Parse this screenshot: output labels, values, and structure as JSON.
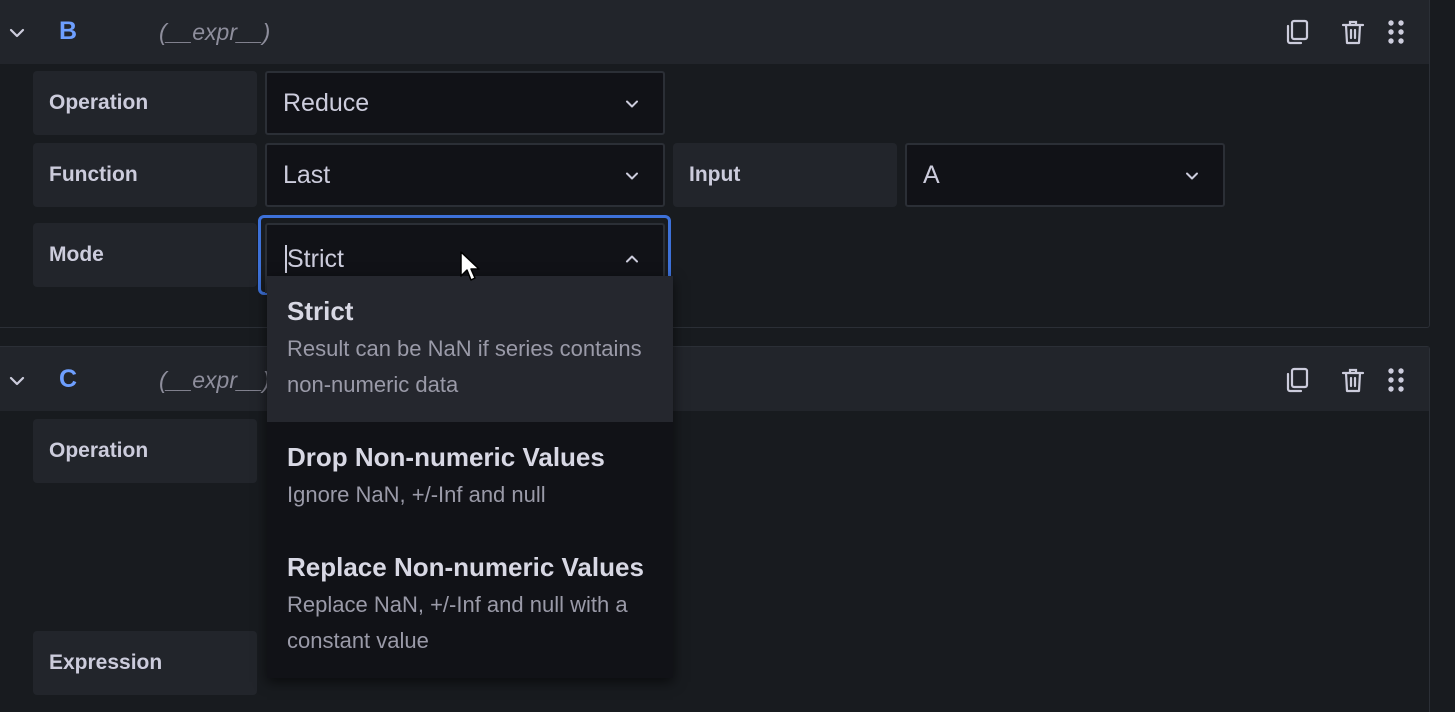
{
  "query_b": {
    "name": "B",
    "type": "(__expr__)",
    "rows": {
      "operation": {
        "label": "Operation",
        "value": "Reduce"
      },
      "function": {
        "label": "Function",
        "value": "Last"
      },
      "input": {
        "label": "Input",
        "value": "A"
      },
      "mode": {
        "label": "Mode",
        "value": "Strict"
      }
    }
  },
  "mode_dropdown": {
    "options": [
      {
        "title": "Strict",
        "description": "Result can be NaN if series contains non-numeric data"
      },
      {
        "title": "Drop Non-numeric Values",
        "description": "Ignore NaN, +/-Inf and null"
      },
      {
        "title": "Replace Non-numeric Values",
        "description": "Replace NaN, +/-Inf and null with a constant value"
      }
    ],
    "highlighted_index": 0
  },
  "query_c": {
    "name": "C",
    "type": "(__expr__)",
    "rows": {
      "operation": {
        "label": "Operation"
      },
      "expression": {
        "label": "Expression"
      }
    }
  },
  "icons": {
    "collapse": "chevron-down-icon",
    "duplicate": "copy-icon",
    "delete": "trash-icon",
    "drag": "drag-handle-icon",
    "select": "chevron-down-icon",
    "select_open": "chevron-up-icon"
  },
  "colors": {
    "background": "#181b1f",
    "header": "#22252b",
    "accent": "#6e9fff",
    "focus": "#3d71d9"
  }
}
